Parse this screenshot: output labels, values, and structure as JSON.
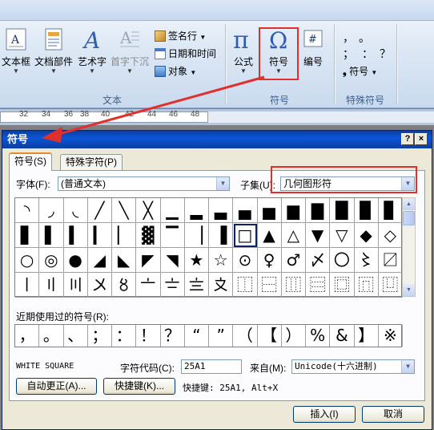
{
  "ribbon": {
    "groups": [
      {
        "label": "文本",
        "buttons": [
          "文本框",
          "文档部件",
          "艺术字",
          "首字下沉"
        ],
        "small": [
          "签名行",
          "日期和时间",
          "对象"
        ]
      },
      {
        "label": "符号",
        "buttons": [
          "公式",
          "符号",
          "编号"
        ]
      },
      {
        "label": "特殊符号",
        "small_glyphs": [
          "，",
          "。",
          "；",
          "：",
          "？"
        ],
        "small_button": "符号"
      }
    ]
  },
  "ruler": {
    "ticks": [
      "32",
      "34",
      "36",
      "38",
      "40",
      "42",
      "44",
      "46",
      "48"
    ]
  },
  "dialog": {
    "title": "符号",
    "help_button": "?",
    "close_button": "×",
    "tabs": [
      "符号(S)",
      "特殊字符(P)"
    ],
    "font_label": "字体(F):",
    "font_value": "(普通文本)",
    "subset_label": "子集(U):",
    "subset_value": "几何图形符",
    "grid_rows": [
      [
        "◝",
        "◞",
        "◟",
        "╱",
        "╲",
        "╳",
        "▁",
        "▂",
        "▃",
        "▄",
        "▅",
        "▆",
        "▇",
        "█",
        "▉",
        "▊"
      ],
      [
        "▋",
        "▌",
        "▍",
        "▎",
        "▏",
        "▓",
        "▔",
        "▕",
        "▐",
        "□",
        "▲",
        "△",
        "▼",
        "▽",
        "◆",
        "◇"
      ],
      [
        "○",
        "◎",
        "●",
        "◢",
        "◣",
        "◤",
        "◥",
        "★",
        "☆",
        "⊙",
        "♀",
        "♂",
        "〆",
        "〇",
        "〻",
        "〼"
      ],
      [
        "〡",
        "〢",
        "〣",
        "〤",
        "〥",
        "〦",
        "〧",
        "〨",
        "〩",
        "⿰",
        "⿱",
        "⿲",
        "⿳",
        "⿴",
        "⿵",
        "⿶"
      ]
    ],
    "selected_index": 25,
    "recent_label": "近期使用过的符号(R):",
    "recent": [
      "，",
      "。",
      "、",
      "；",
      "：",
      "！",
      "？",
      "“",
      "”",
      "（",
      "【",
      "）",
      "%",
      "&",
      "】",
      "※"
    ],
    "char_name": "WHITE SQUARE",
    "char_code_label": "字符代码(C):",
    "char_code": "25A1",
    "from_label": "来自(M):",
    "from_value": "Unicode(十六进制)",
    "autocorrect_button": "自动更正(A)...",
    "shortcut_button": "快捷键(K)...",
    "shortcut_text": "快捷键: 25A1, Alt+X",
    "insert_button": "插入(I)",
    "cancel_button": "取消"
  },
  "colors": {
    "highlight": "#e0302e",
    "titlebar": "#0b55d8",
    "ribbon_text": "#15428b"
  }
}
